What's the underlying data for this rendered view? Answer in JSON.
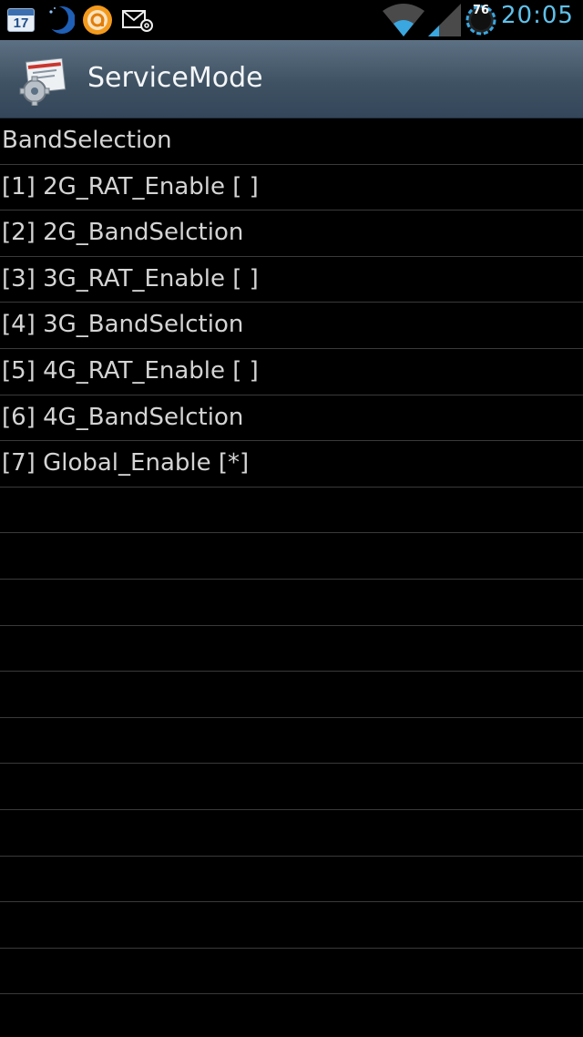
{
  "status_bar": {
    "icons": [
      "calendar-icon",
      "moon-icon",
      "orange-app-icon",
      "mail-icon",
      "wifi-icon",
      "signal-icon",
      "battery-icon"
    ],
    "calendar_day": "17",
    "battery_level": "76",
    "time": "20:05",
    "colors": {
      "clock": "#5fc1ea",
      "background": "#000000"
    }
  },
  "title_bar": {
    "title": "ServiceMode",
    "icon": "service-mode-app-icon",
    "colors": {
      "top": "#5d7184",
      "bottom": "#34465a"
    }
  },
  "list": {
    "items": [
      "BandSelection",
      "[1] 2G_RAT_Enable [ ]",
      "[2] 2G_BandSelction",
      "[3] 3G_RAT_Enable [ ]",
      "[4] 3G_BandSelction",
      "[5] 4G_RAT_Enable [ ]",
      "[6] 4G_BandSelction",
      "[7] Global_Enable [*]",
      "",
      "",
      "",
      "",
      "",
      "",
      "",
      "",
      "",
      "",
      "",
      ""
    ]
  }
}
